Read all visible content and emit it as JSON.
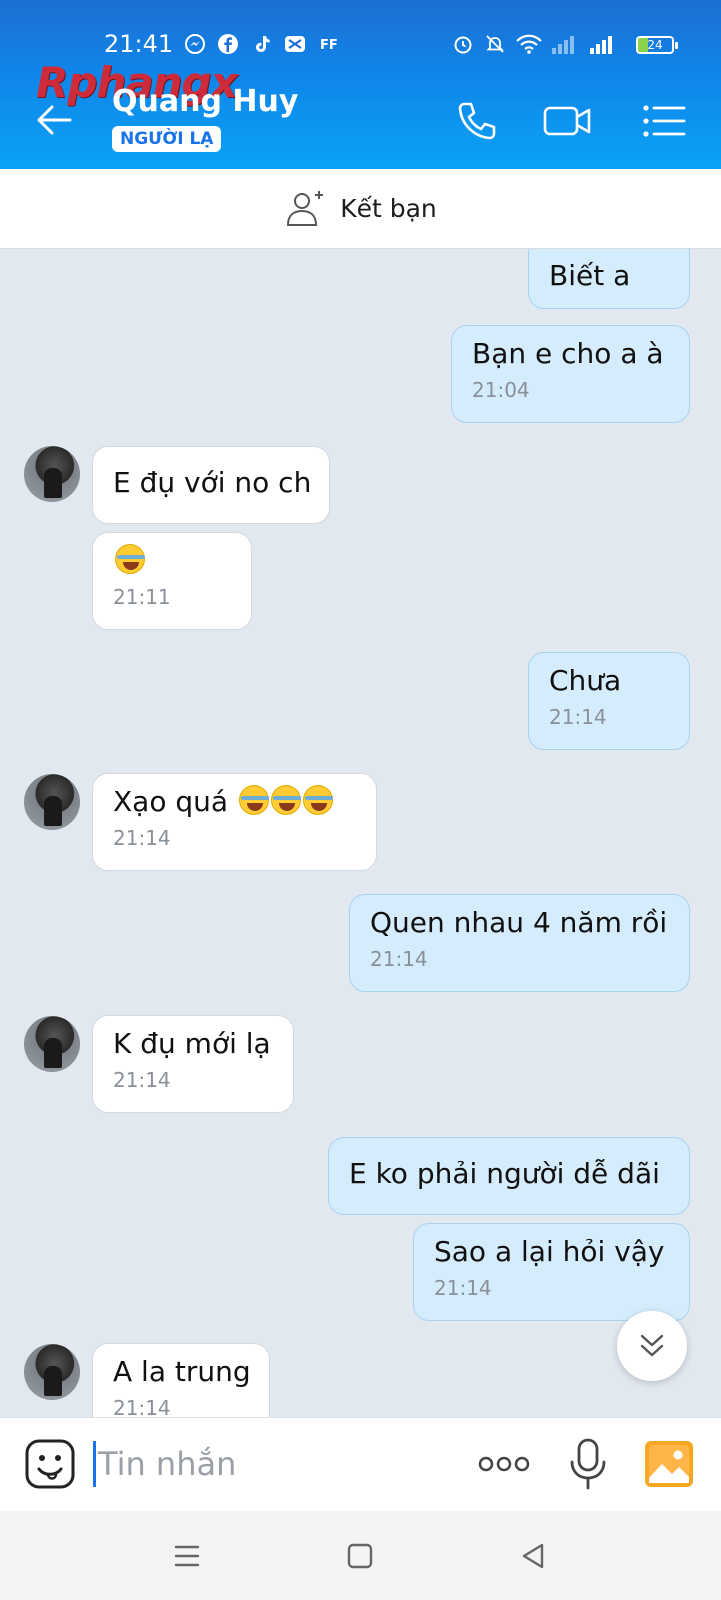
{
  "status_bar": {
    "time": "21:41",
    "battery": "24",
    "icons": [
      "messenger-icon",
      "facebook-icon",
      "tiktok-icon",
      "capcut-icon",
      "ff-icon",
      "alarm-icon",
      "mute-icon",
      "wifi-icon",
      "signal-icon",
      "signal-icon",
      "battery-icon"
    ]
  },
  "watermark": "Rphangx",
  "header": {
    "contact_name": "Quang Huy",
    "badge": "NGƯỜI LẠ",
    "accent_color": "#0f86ea",
    "actions": [
      "phone-icon",
      "video-call-icon",
      "menu-list-icon"
    ]
  },
  "add_friend": {
    "label": "Kết bạn"
  },
  "messages": [
    {
      "side": "out",
      "text": "Biết a",
      "time": ""
    },
    {
      "side": "out",
      "text": "Bạn e cho a à",
      "time": "21:04"
    },
    {
      "side": "in",
      "text": "E đụ với no ch",
      "time": ""
    },
    {
      "side": "in",
      "text": "",
      "emoji": "rofl",
      "time": "21:11"
    },
    {
      "side": "out",
      "text": "Chưa",
      "time": "21:14"
    },
    {
      "side": "in",
      "text": "Xạo quá",
      "emoji_trail": [
        "joy",
        "rofl",
        "rofl"
      ],
      "time": "21:14"
    },
    {
      "side": "out",
      "text": "Quen nhau 4 năm rồi",
      "time": "21:14"
    },
    {
      "side": "in",
      "text": "K đụ mới lạ",
      "time": "21:14"
    },
    {
      "side": "out",
      "text": "E ko phải người dễ dãi",
      "time": ""
    },
    {
      "side": "out",
      "text": "Sao a lại hỏi vậy",
      "time": "21:14"
    },
    {
      "side": "in",
      "text": "A la trung",
      "time": "21:14"
    }
  ],
  "input": {
    "placeholder": "Tin nhắn"
  }
}
